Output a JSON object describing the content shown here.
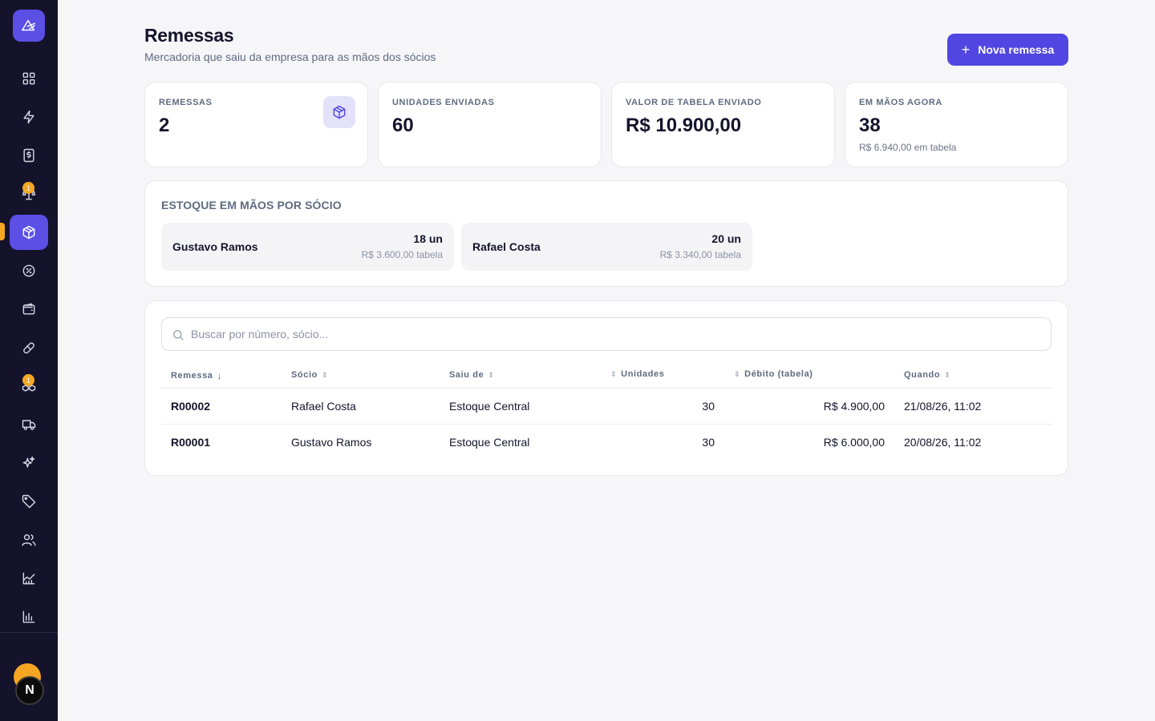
{
  "sidebar": {
    "logo_icon": "logo-icon",
    "active_index": 4,
    "items": [
      {
        "icon": "dashboard-icon",
        "badge": null
      },
      {
        "icon": "lightning-icon",
        "badge": null
      },
      {
        "icon": "dollar-icon",
        "badge": null
      },
      {
        "icon": "scale-icon",
        "badge": "1"
      },
      {
        "icon": "package-icon",
        "badge": null
      },
      {
        "icon": "gauge-icon",
        "badge": null
      },
      {
        "icon": "wallet-icon",
        "badge": null
      },
      {
        "icon": "pill-icon",
        "badge": null
      },
      {
        "icon": "boxes-icon",
        "badge": "1"
      },
      {
        "icon": "truck-icon",
        "badge": null
      },
      {
        "icon": "sparkles-icon",
        "badge": null
      },
      {
        "icon": "tag-icon",
        "badge": null
      },
      {
        "icon": "users-icon",
        "badge": null
      },
      {
        "icon": "factory-icon",
        "badge": null
      },
      {
        "icon": "bar-chart-icon",
        "badge": null
      }
    ],
    "avatar_back": "",
    "avatar_front": "N"
  },
  "header": {
    "title": "Remessas",
    "subtitle": "Mercadoria que saiu da empresa para as mãos dos sócios",
    "new_button": "Nova remessa"
  },
  "stats": [
    {
      "label": "REMESSAS",
      "value": "2",
      "sub": ""
    },
    {
      "label": "UNIDADES ENVIADAS",
      "value": "60",
      "sub": ""
    },
    {
      "label": "VALOR DE TABELA ENVIADO",
      "value": "R$ 10.900,00",
      "sub": ""
    },
    {
      "label": "EM MÃOS AGORA",
      "value": "38",
      "sub": "R$ 6.940,00 em tabela"
    }
  ],
  "partners": {
    "heading": "ESTOQUE EM MÃOS POR SÓCIO",
    "items": [
      {
        "name": "Gustavo Ramos",
        "units": "18 un",
        "value": "R$ 3.600,00 tabela"
      },
      {
        "name": "Rafael Costa",
        "units": "20 un",
        "value": "R$ 3.340,00 tabela"
      }
    ]
  },
  "search": {
    "placeholder": "Buscar por número, sócio...",
    "value": ""
  },
  "table": {
    "columns": [
      "Remessa",
      "Sócio",
      "Saiu de",
      "Unidades",
      "Débito (tabela)",
      "Quando"
    ],
    "rows": [
      {
        "id": "R00002",
        "socio": "Rafael Costa",
        "origem": "Estoque Central",
        "unidades": "30",
        "debito": "R$ 4.900,00",
        "quando": "21/08/26, 11:02"
      },
      {
        "id": "R00001",
        "socio": "Gustavo Ramos",
        "origem": "Estoque Central",
        "unidades": "30",
        "debito": "R$ 6.000,00",
        "quando": "20/08/26, 11:02"
      }
    ]
  },
  "colors": {
    "sidebar": "#15132b",
    "accent": "#5146e1",
    "badge": "#f5a623"
  }
}
